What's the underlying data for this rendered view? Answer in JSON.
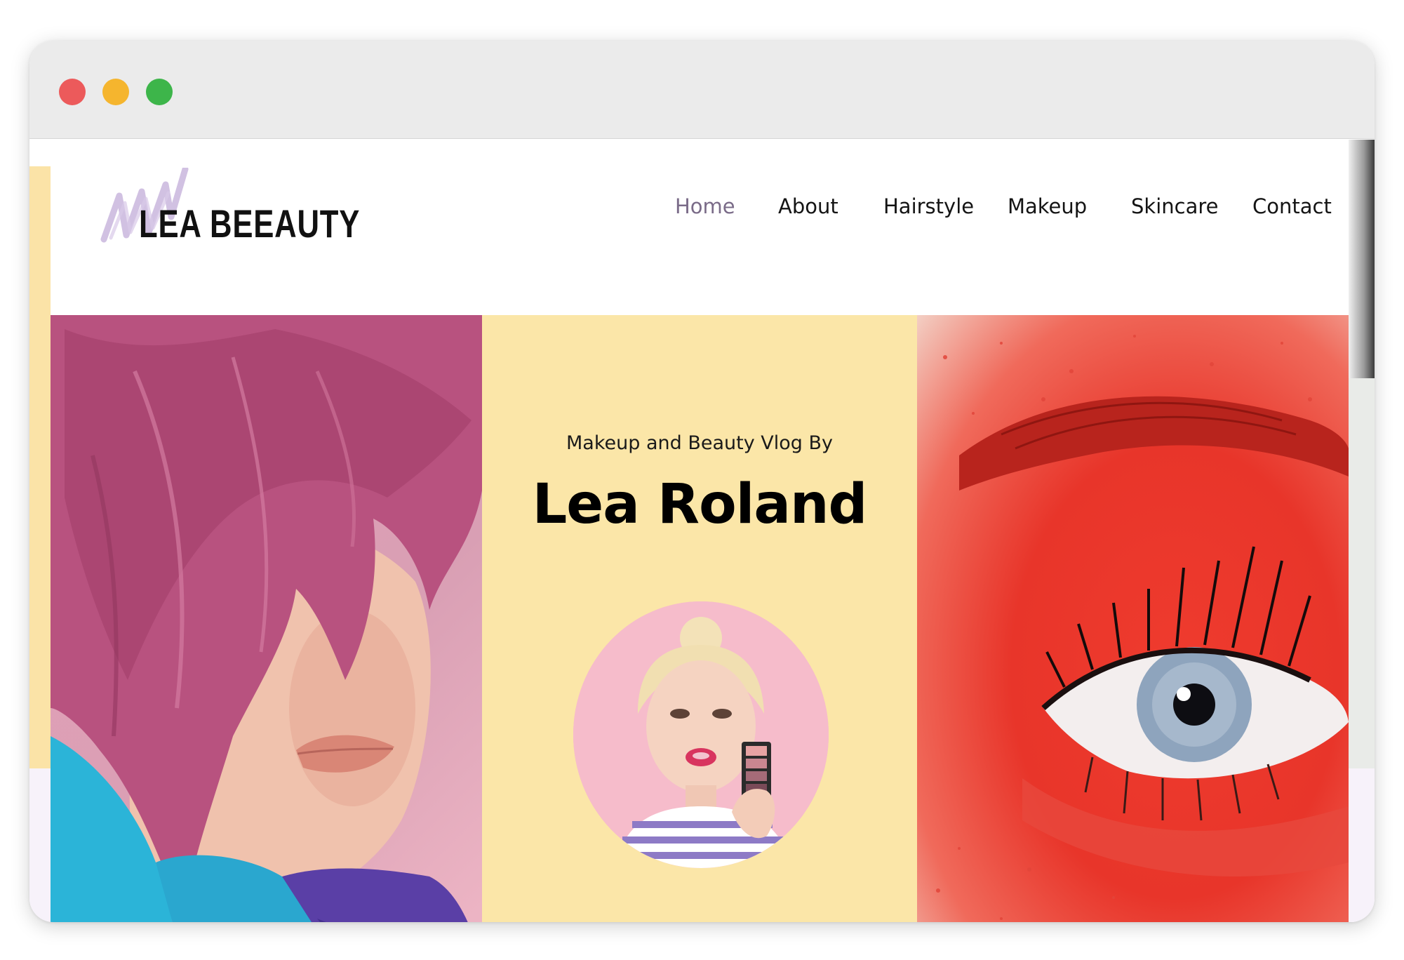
{
  "site": {
    "logo_text": "LEA BEEAUTY",
    "colors": {
      "accent_yellow": "#fbe6a8",
      "active_nav": "#7a6b88",
      "text": "#141414",
      "logo_scribble": "#c9b6dd"
    }
  },
  "nav": {
    "items": [
      {
        "label": "Home",
        "active": true
      },
      {
        "label": "About",
        "active": false
      },
      {
        "label": "Hairstyle",
        "active": false
      },
      {
        "label": "Makeup",
        "active": false
      },
      {
        "label": "Skincare",
        "active": false
      },
      {
        "label": "Contact",
        "active": false
      }
    ]
  },
  "hero": {
    "subtitle": "Makeup and Beauty Vlog By",
    "name": "Lea Roland"
  },
  "window": {
    "controls": [
      "close",
      "minimize",
      "maximize"
    ]
  }
}
